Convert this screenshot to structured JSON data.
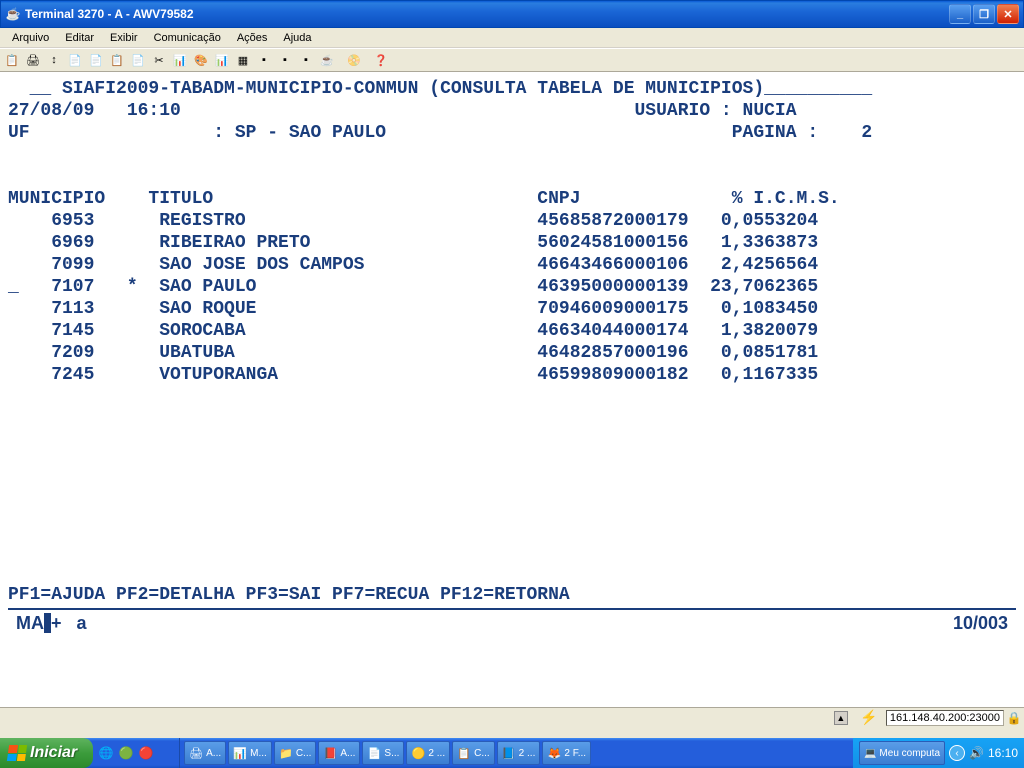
{
  "window": {
    "title": "Terminal 3270 - A - AWV79582"
  },
  "menu": [
    "Arquivo",
    "Editar",
    "Exibir",
    "Comunicação",
    "Ações",
    "Ajuda"
  ],
  "toolbar_icons": [
    "📋",
    "🖨",
    "↕",
    "📄",
    "📄",
    "📋",
    "📄",
    "✂",
    "📊",
    "🎨",
    "📊",
    "▦",
    "▪",
    "▪",
    "▪",
    "☕",
    "",
    "📀",
    "",
    "❓"
  ],
  "screen": {
    "header": "  __ SIAFI2009-TABADM-MUNICIPIO-CONMUN (CONSULTA TABELA DE MUNICIPIOS)__________",
    "date": "27/08/09",
    "time": "16:10",
    "usuario_label": "USUARIO :",
    "usuario": "NUCIA",
    "uf_label": "UF",
    "uf_sep": ":",
    "uf_value": "SP - SAO PAULO",
    "pagina_label": "PAGINA :",
    "pagina": "2",
    "col_municipio": "MUNICIPIO",
    "col_titulo": "TITULO",
    "col_cnpj": "CNPJ",
    "col_icms": "% I.C.M.S.",
    "rows": [
      {
        "cod": "6953",
        "mark": " ",
        "titulo": "REGISTRO",
        "cnpj": "45685872000179",
        "icms": " 0,0553204"
      },
      {
        "cod": "6969",
        "mark": " ",
        "titulo": "RIBEIRAO PRETO",
        "cnpj": "56024581000156",
        "icms": " 1,3363873"
      },
      {
        "cod": "7099",
        "mark": " ",
        "titulo": "SAO JOSE DOS CAMPOS",
        "cnpj": "46643466000106",
        "icms": " 2,4256564"
      },
      {
        "cod": "7107",
        "mark": "*",
        "titulo": "SAO PAULO",
        "cnpj": "46395000000139",
        "icms": "23,7062365"
      },
      {
        "cod": "7113",
        "mark": " ",
        "titulo": "SAO ROQUE",
        "cnpj": "70946009000175",
        "icms": " 0,1083450"
      },
      {
        "cod": "7145",
        "mark": " ",
        "titulo": "SOROCABA",
        "cnpj": "46634044000174",
        "icms": " 1,3820079"
      },
      {
        "cod": "7209",
        "mark": " ",
        "titulo": "UBATUBA",
        "cnpj": "46482857000196",
        "icms": " 0,0851781"
      },
      {
        "cod": "7245",
        "mark": " ",
        "titulo": "VOTUPORANGA",
        "cnpj": "46599809000182",
        "icms": " 0,1167335"
      }
    ],
    "cursor_row_prefix": "_ ",
    "pfkeys": "PF1=AJUDA PF2=DETALHA PF3=SAI PF7=RECUA PF12=RETORNA",
    "status_left_1": "MA",
    "status_left_2": "+",
    "status_left_3": "a",
    "status_right": "10/003"
  },
  "oia": {
    "ip": "161.148.40.200:23000"
  },
  "taskbar": {
    "start": "Iniciar",
    "tasks": [
      {
        "icon": "🖨",
        "label": "A...",
        "active": false
      },
      {
        "icon": "📊",
        "label": "M...",
        "active": false
      },
      {
        "icon": "📁",
        "label": "C...",
        "active": false
      },
      {
        "icon": "📕",
        "label": "A...",
        "active": false
      },
      {
        "icon": "📄",
        "label": "S...",
        "active": false
      },
      {
        "icon": "🟡",
        "label": "2 ...",
        "active": false
      },
      {
        "icon": "📋",
        "label": "C...",
        "active": false
      },
      {
        "icon": "📘",
        "label": "2 ...",
        "active": false
      },
      {
        "icon": "🦊",
        "label": "2 F...",
        "active": false
      }
    ],
    "quicklaunch": [
      "🌐",
      "🟢",
      "🔴",
      ""
    ],
    "mycomputer": "Meu computa",
    "clock": "16:10"
  }
}
